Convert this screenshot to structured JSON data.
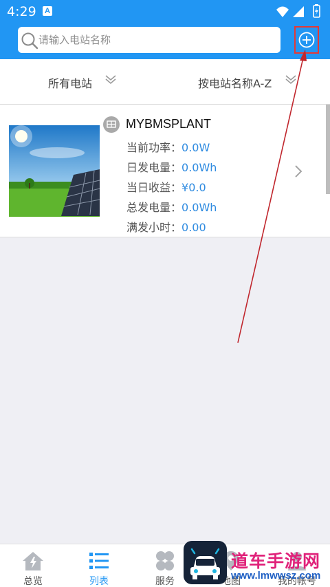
{
  "status_bar": {
    "time": "4:29",
    "notification_glyph": "A"
  },
  "search": {
    "placeholder": "请输入电站名称"
  },
  "filters": [
    {
      "label": "所有电站"
    },
    {
      "label": "按电站名称A-Z"
    }
  ],
  "plant": {
    "name": "MYBMSPLANT",
    "stats": [
      {
        "label": "当前功率：",
        "value": "0.0W"
      },
      {
        "label": "日发电量：",
        "value": "0.0Wh"
      },
      {
        "label": "当日收益：",
        "value": "¥0.0"
      },
      {
        "label": "总发电量：",
        "value": "0.0Wh"
      },
      {
        "label": "满发小时：",
        "value": "0.00"
      }
    ]
  },
  "tabs": [
    {
      "label": "总览",
      "icon": "home-icon"
    },
    {
      "label": "列表",
      "icon": "list-icon",
      "active": true
    },
    {
      "label": "服务",
      "icon": "clover-icon"
    },
    {
      "label": "地图",
      "icon": "map-icon"
    },
    {
      "label": "我的帐号",
      "icon": "account-icon"
    }
  ],
  "watermark": {
    "title": "道车手游网",
    "url": "www.lmwwsz.com"
  },
  "colors": {
    "primary": "#2196f3",
    "value_blue": "#2f8be0",
    "highlight_red": "#e53935",
    "watermark_pink": "#e0227a"
  }
}
